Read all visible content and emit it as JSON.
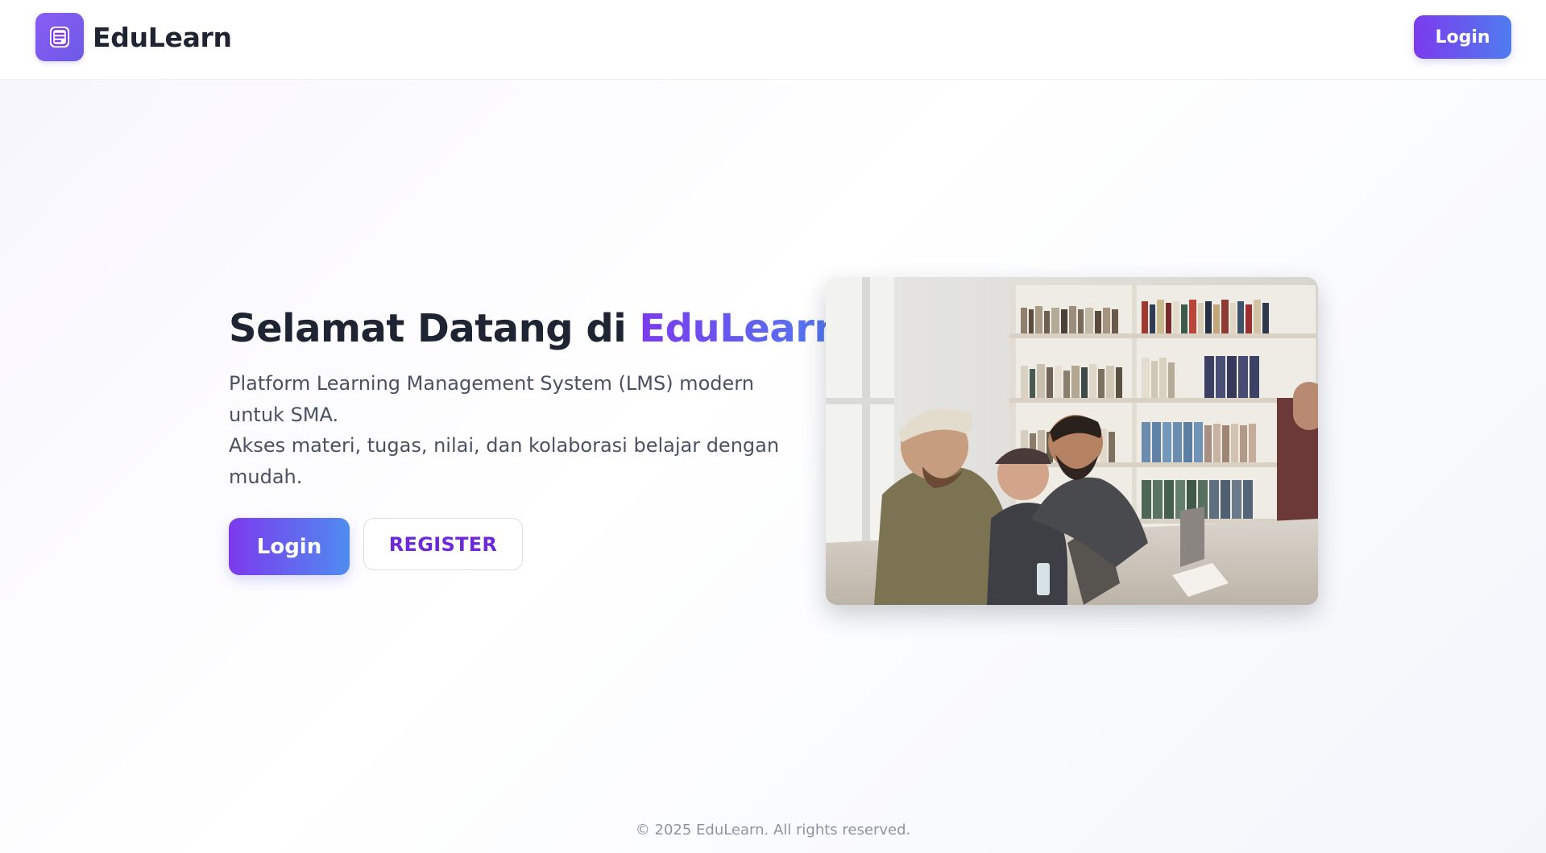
{
  "header": {
    "brand_name": "EduLearn",
    "login_label": "Login",
    "logo_icon": "document-icon"
  },
  "hero": {
    "title_prefix": "Selamat Datang di ",
    "title_highlight": "EduLearn",
    "description_line1": "Platform Learning Management System (LMS) modern untuk SMA.",
    "description_line2": "Akses materi, tugas, nilai, dan kolaborasi belajar dengan mudah.",
    "login_label": "Login",
    "register_label": "REGISTER"
  },
  "footer": {
    "copyright": "© 2025 EduLearn. All rights reserved."
  },
  "colors": {
    "brand_purple": "#7c3aed",
    "brand_blue": "#4f7cf0",
    "register_text": "#6d28d9",
    "text_dark": "#1f2433"
  }
}
